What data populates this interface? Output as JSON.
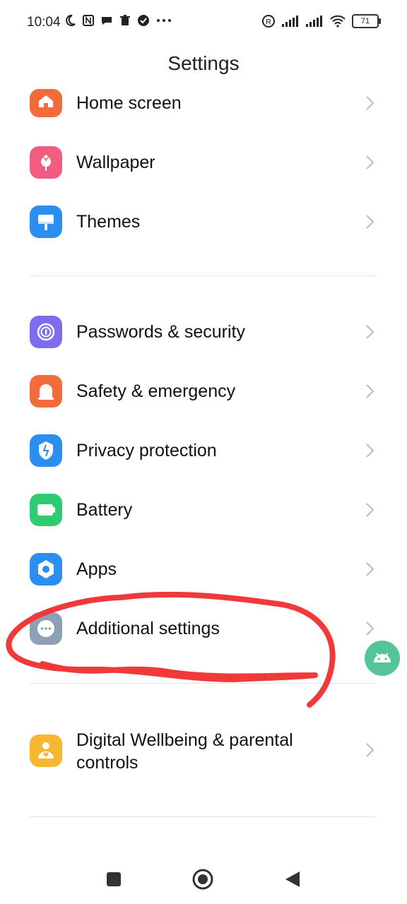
{
  "status_bar": {
    "time": "10:04",
    "battery_level": "71",
    "left_icons": [
      "moon-icon",
      "nfc-icon",
      "chat-icon",
      "trash-icon",
      "check-badge-icon",
      "more-dots-icon"
    ],
    "right_icons": [
      "registered-icon",
      "signal-icon",
      "signal-icon",
      "wifi-icon",
      "battery-icon"
    ]
  },
  "header": {
    "title": "Settings"
  },
  "groups": [
    {
      "items": [
        {
          "label": "Home screen",
          "icon": "home-icon",
          "color": "#f26b3a"
        },
        {
          "label": "Wallpaper",
          "icon": "tulip-icon",
          "color": "#f25c7f"
        },
        {
          "label": "Themes",
          "icon": "paint-roller-icon",
          "color": "#2b8ef0"
        }
      ]
    },
    {
      "items": [
        {
          "label": "Passwords & security",
          "icon": "lock-icon",
          "color": "#7b6cf0"
        },
        {
          "label": "Safety & emergency",
          "icon": "alarm-light-icon",
          "color": "#f26b3a"
        },
        {
          "label": "Privacy protection",
          "icon": "shield-icon",
          "color": "#2b8ef0"
        },
        {
          "label": "Battery",
          "icon": "battery-icon",
          "color": "#2ecc71"
        },
        {
          "label": "Apps",
          "icon": "gear-icon",
          "color": "#2b8ef0"
        },
        {
          "label": "Additional settings",
          "icon": "more-dots-icon",
          "color": "#8ea0b5"
        }
      ]
    },
    {
      "items": [
        {
          "label": "Digital Wellbeing & parental controls",
          "icon": "person-heart-icon",
          "color": "#f7b731"
        }
      ]
    }
  ],
  "annotation": {
    "color": "#f03a3a",
    "target": "Additional settings"
  },
  "floating_button": {
    "icon": "android-icon",
    "color": "#56c596"
  },
  "nav_bar": {
    "icons": [
      "recents-square-icon",
      "home-circle-icon",
      "back-triangle-icon"
    ]
  }
}
